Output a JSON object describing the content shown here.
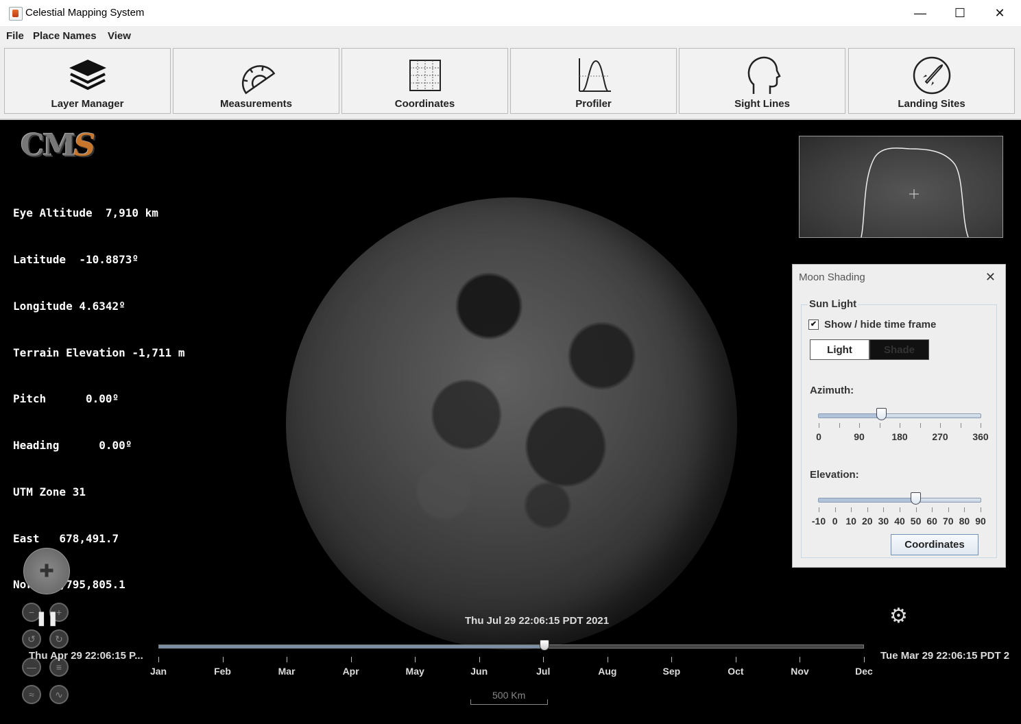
{
  "window": {
    "title": "Celestial Mapping System"
  },
  "menu": [
    "File",
    "Place Names",
    "View"
  ],
  "toolbar": [
    {
      "label": "Layer Manager",
      "icon": "layers-icon"
    },
    {
      "label": "Measurements",
      "icon": "protractor-icon"
    },
    {
      "label": "Coordinates",
      "icon": "grid-icon"
    },
    {
      "label": "Profiler",
      "icon": "profile-curve-icon"
    },
    {
      "label": "Sight Lines",
      "icon": "head-profile-icon"
    },
    {
      "label": "Landing Sites",
      "icon": "rocket-icon"
    }
  ],
  "logo": {
    "text_main": "CM",
    "text_accent": "S"
  },
  "info": {
    "lines": [
      "Eye Altitude  7,910 km",
      "Latitude  -10.8873º",
      "Longitude 4.6342º",
      "Terrain Elevation -1,711 m",
      "Pitch      0.00º",
      "Heading      0.00º",
      "UTM Zone 31",
      "East   678,491.7",
      "North 8,795,805.1"
    ]
  },
  "panel": {
    "title": "Moon Shading",
    "group_title": "Sun Light",
    "checkbox_label": "Show / hide time frame",
    "checkbox_checked": true,
    "light_label": "Light",
    "shade_label": "Shade",
    "azimuth": {
      "label": "Azimuth:",
      "value": 140,
      "min": 0,
      "max": 360,
      "tick_labels": [
        "0",
        "90",
        "180",
        "270",
        "360"
      ],
      "minor_ticks": 9
    },
    "elevation": {
      "label": "Elevation:",
      "value": 50,
      "min": -10,
      "max": 90,
      "tick_labels": [
        "-10",
        "0",
        "10",
        "20",
        "30",
        "40",
        "50",
        "60",
        "70",
        "80",
        "90"
      ]
    },
    "coordinates_button": "Coordinates"
  },
  "timeline": {
    "current_date": "Thu Jul 29 22:06:15 PDT 2021",
    "start_date": "Thu Apr 29 22:06:15 P...",
    "end_date": "Tue Mar 29 22:06:15 PDT 2",
    "months": [
      "Jan",
      "Feb",
      "Mar",
      "Apr",
      "May",
      "Jun",
      "Jul",
      "Aug",
      "Sep",
      "Oct",
      "Nov",
      "Dec"
    ],
    "position_fraction": 0.547
  },
  "scale": {
    "label": "500 Km"
  },
  "controls": {
    "pause_label": "❚❚"
  }
}
